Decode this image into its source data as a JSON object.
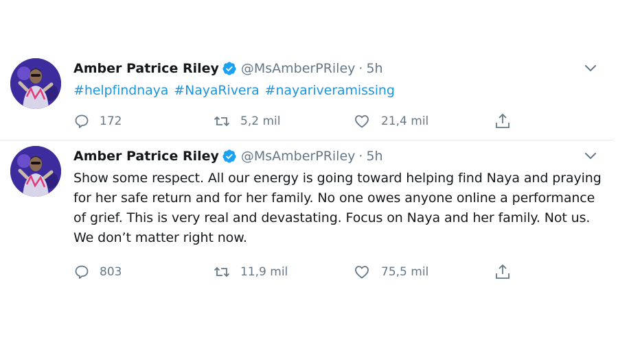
{
  "tweets": [
    {
      "name": "Amber Patrice Riley",
      "handle": "@MsAmberPRiley",
      "separator": "·",
      "time": "5h",
      "text": "#helpfindnaya #NayaRivera #nayariveramissing",
      "is_hashtags": true,
      "replies": "172",
      "retweets": "5,2 mil",
      "likes": "21,4 mil"
    },
    {
      "name": "Amber Patrice Riley",
      "handle": "@MsAmberPRiley",
      "separator": "·",
      "time": "5h",
      "text": "Show some respect. All our energy is going toward helping find Naya and praying for her safe return and for her family. No one owes anyone online a performance of grief. This is very real and devastating. Focus on Naya and her family. Not us. We don’t matter right now.",
      "is_hashtags": false,
      "replies": "803",
      "retweets": "11,9 mil",
      "likes": "75,5 mil"
    }
  ],
  "colors": {
    "link": "#1b95e0",
    "muted": "#657786",
    "verified": "#1da1f2",
    "text": "#14171a"
  },
  "icons": {
    "reply": "speech-bubble-icon",
    "retweet": "retweet-arrows-icon",
    "like": "heart-outline-icon",
    "share": "share-upload-icon",
    "verified": "verified-badge-icon",
    "menu": "chevron-down-icon"
  }
}
